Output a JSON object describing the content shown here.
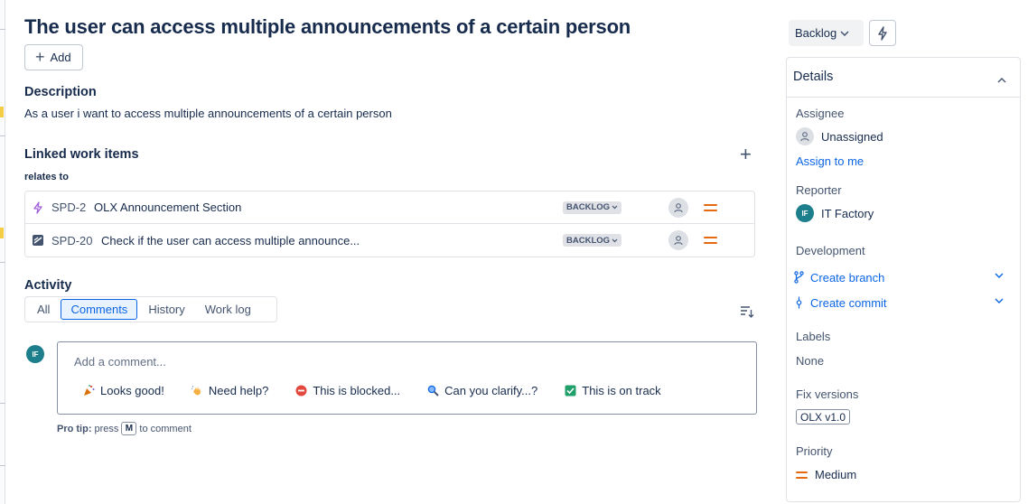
{
  "issue": {
    "title": "The user can access multiple announcements of a certain person",
    "add_label": "Add"
  },
  "description": {
    "heading": "Description",
    "text": "As a user i want to access multiple announcements of a certain person"
  },
  "linked": {
    "heading": "Linked work items",
    "relation": "relates to",
    "items": [
      {
        "key": "SPD-2",
        "summary": "OLX Announcement Section",
        "status": "BACKLOG",
        "type_icon": "epic-lightning-icon",
        "priority": "Medium"
      },
      {
        "key": "SPD-20",
        "summary": "Check if the user can access multiple announce...",
        "status": "BACKLOG",
        "type_icon": "test-icon",
        "priority": "Medium"
      }
    ]
  },
  "activity": {
    "heading": "Activity",
    "tabs": [
      "All",
      "Comments",
      "History",
      "Work log"
    ],
    "active_tab": "Comments",
    "user_initials": "IF",
    "comment_placeholder": "Add a comment...",
    "quick_replies": [
      {
        "label": "Looks good!",
        "icon": "party-popper-icon"
      },
      {
        "label": "Need help?",
        "icon": "waving-hand-icon"
      },
      {
        "label": "This is blocked...",
        "icon": "no-entry-icon"
      },
      {
        "label": "Can you clarify...?",
        "icon": "magnifier-icon"
      },
      {
        "label": "This is on track",
        "icon": "check-box-icon"
      }
    ],
    "protip_prefix": "Pro tip:",
    "protip_press": "press",
    "protip_key": "M",
    "protip_suffix": "to comment"
  },
  "sidebar": {
    "status_label": "Backlog",
    "details_heading": "Details",
    "assignee_label": "Assignee",
    "assignee_value": "Unassigned",
    "assign_to_me": "Assign to me",
    "reporter_label": "Reporter",
    "reporter_initials": "IF",
    "reporter_value": "IT Factory",
    "development_label": "Development",
    "create_branch": "Create branch",
    "create_commit": "Create commit",
    "labels_label": "Labels",
    "labels_value": "None",
    "fix_versions_label": "Fix versions",
    "fix_version_value": "OLX v1.0",
    "priority_label": "Priority",
    "priority_value": "Medium"
  },
  "colors": {
    "accent": "#0c66e4",
    "priority_medium": "#e56910",
    "avatar_teal": "#1d7f8c"
  }
}
